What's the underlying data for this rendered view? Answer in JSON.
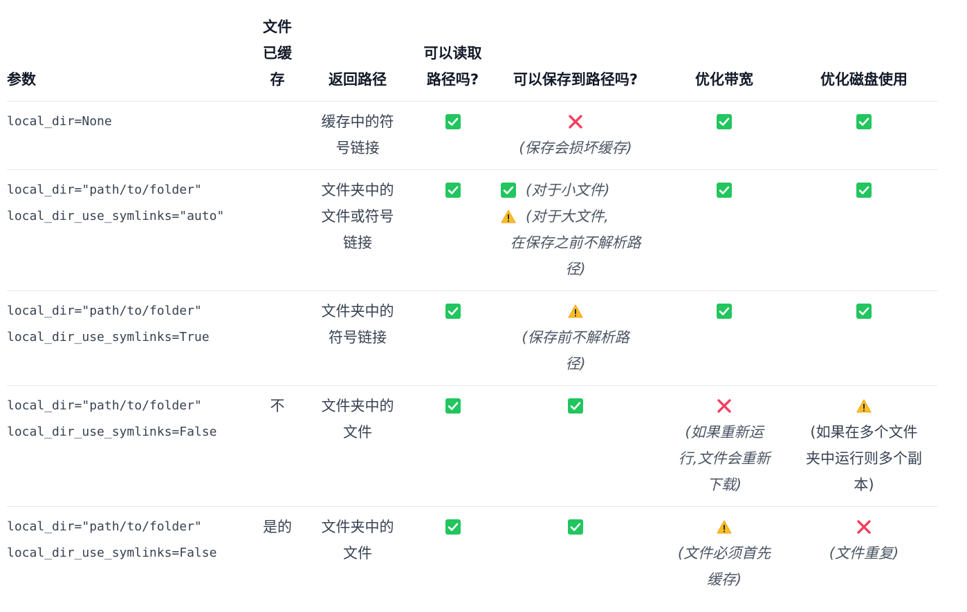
{
  "headers": {
    "param": "参数",
    "cached": [
      "文件",
      "已缓",
      "存"
    ],
    "return_path": "返回路径",
    "can_read": [
      "可以读取",
      "路径吗?"
    ],
    "can_save": "可以保存到路径吗?",
    "opt_bandwidth": "优化带宽",
    "opt_disk": "优化磁盘使用"
  },
  "rows": [
    {
      "code": [
        "local_dir=None"
      ],
      "cached": "",
      "return_path": [
        "缓存中的符",
        "号链接"
      ],
      "save_note": [
        "(保存会损坏缓存)"
      ],
      "bw_note": [],
      "disk_note": []
    },
    {
      "code": [
        "local_dir=\"path/to/folder\"",
        "local_dir_use_symlinks=\"auto\""
      ],
      "cached": "",
      "return_path": [
        "文件夹中的",
        "文件或符号",
        "链接"
      ],
      "save_note_small": "(对于小文件)",
      "save_note_large": "(对于大文件,",
      "save_note_rest": [
        "在保存之前不解析路",
        "径)"
      ],
      "bw_note": [],
      "disk_note": []
    },
    {
      "code": [
        "local_dir=\"path/to/folder\"",
        "local_dir_use_symlinks=True"
      ],
      "cached": "",
      "return_path": [
        "文件夹中的",
        "符号链接"
      ],
      "save_note": [
        "(保存前不解析路",
        "径)"
      ],
      "bw_note": [],
      "disk_note": []
    },
    {
      "code": [
        "local_dir=\"path/to/folder\"",
        "local_dir_use_symlinks=False"
      ],
      "cached": "不",
      "return_path": [
        "文件夹中的",
        "文件"
      ],
      "save_note": [],
      "bw_note": [
        "(如果重新运",
        "行,文件会重新",
        "下载)"
      ],
      "disk_note": [
        "(如果在多个文件",
        "夹中运行则多个副",
        "本)"
      ]
    },
    {
      "code": [
        "local_dir=\"path/to/folder\"",
        "local_dir_use_symlinks=False"
      ],
      "cached": "是的",
      "return_path": [
        "文件夹中的",
        "文件"
      ],
      "save_note": [],
      "bw_note": [
        "(文件必须首先",
        "缓存)"
      ],
      "disk_note": [
        "(文件重复)"
      ]
    }
  ],
  "icons": {
    "yes": "check-icon",
    "no": "cross-icon",
    "warn": "warning-icon"
  },
  "colors": {
    "check": "#22c55e",
    "cross": "#f43f5e",
    "warning": "#fbbf24"
  }
}
